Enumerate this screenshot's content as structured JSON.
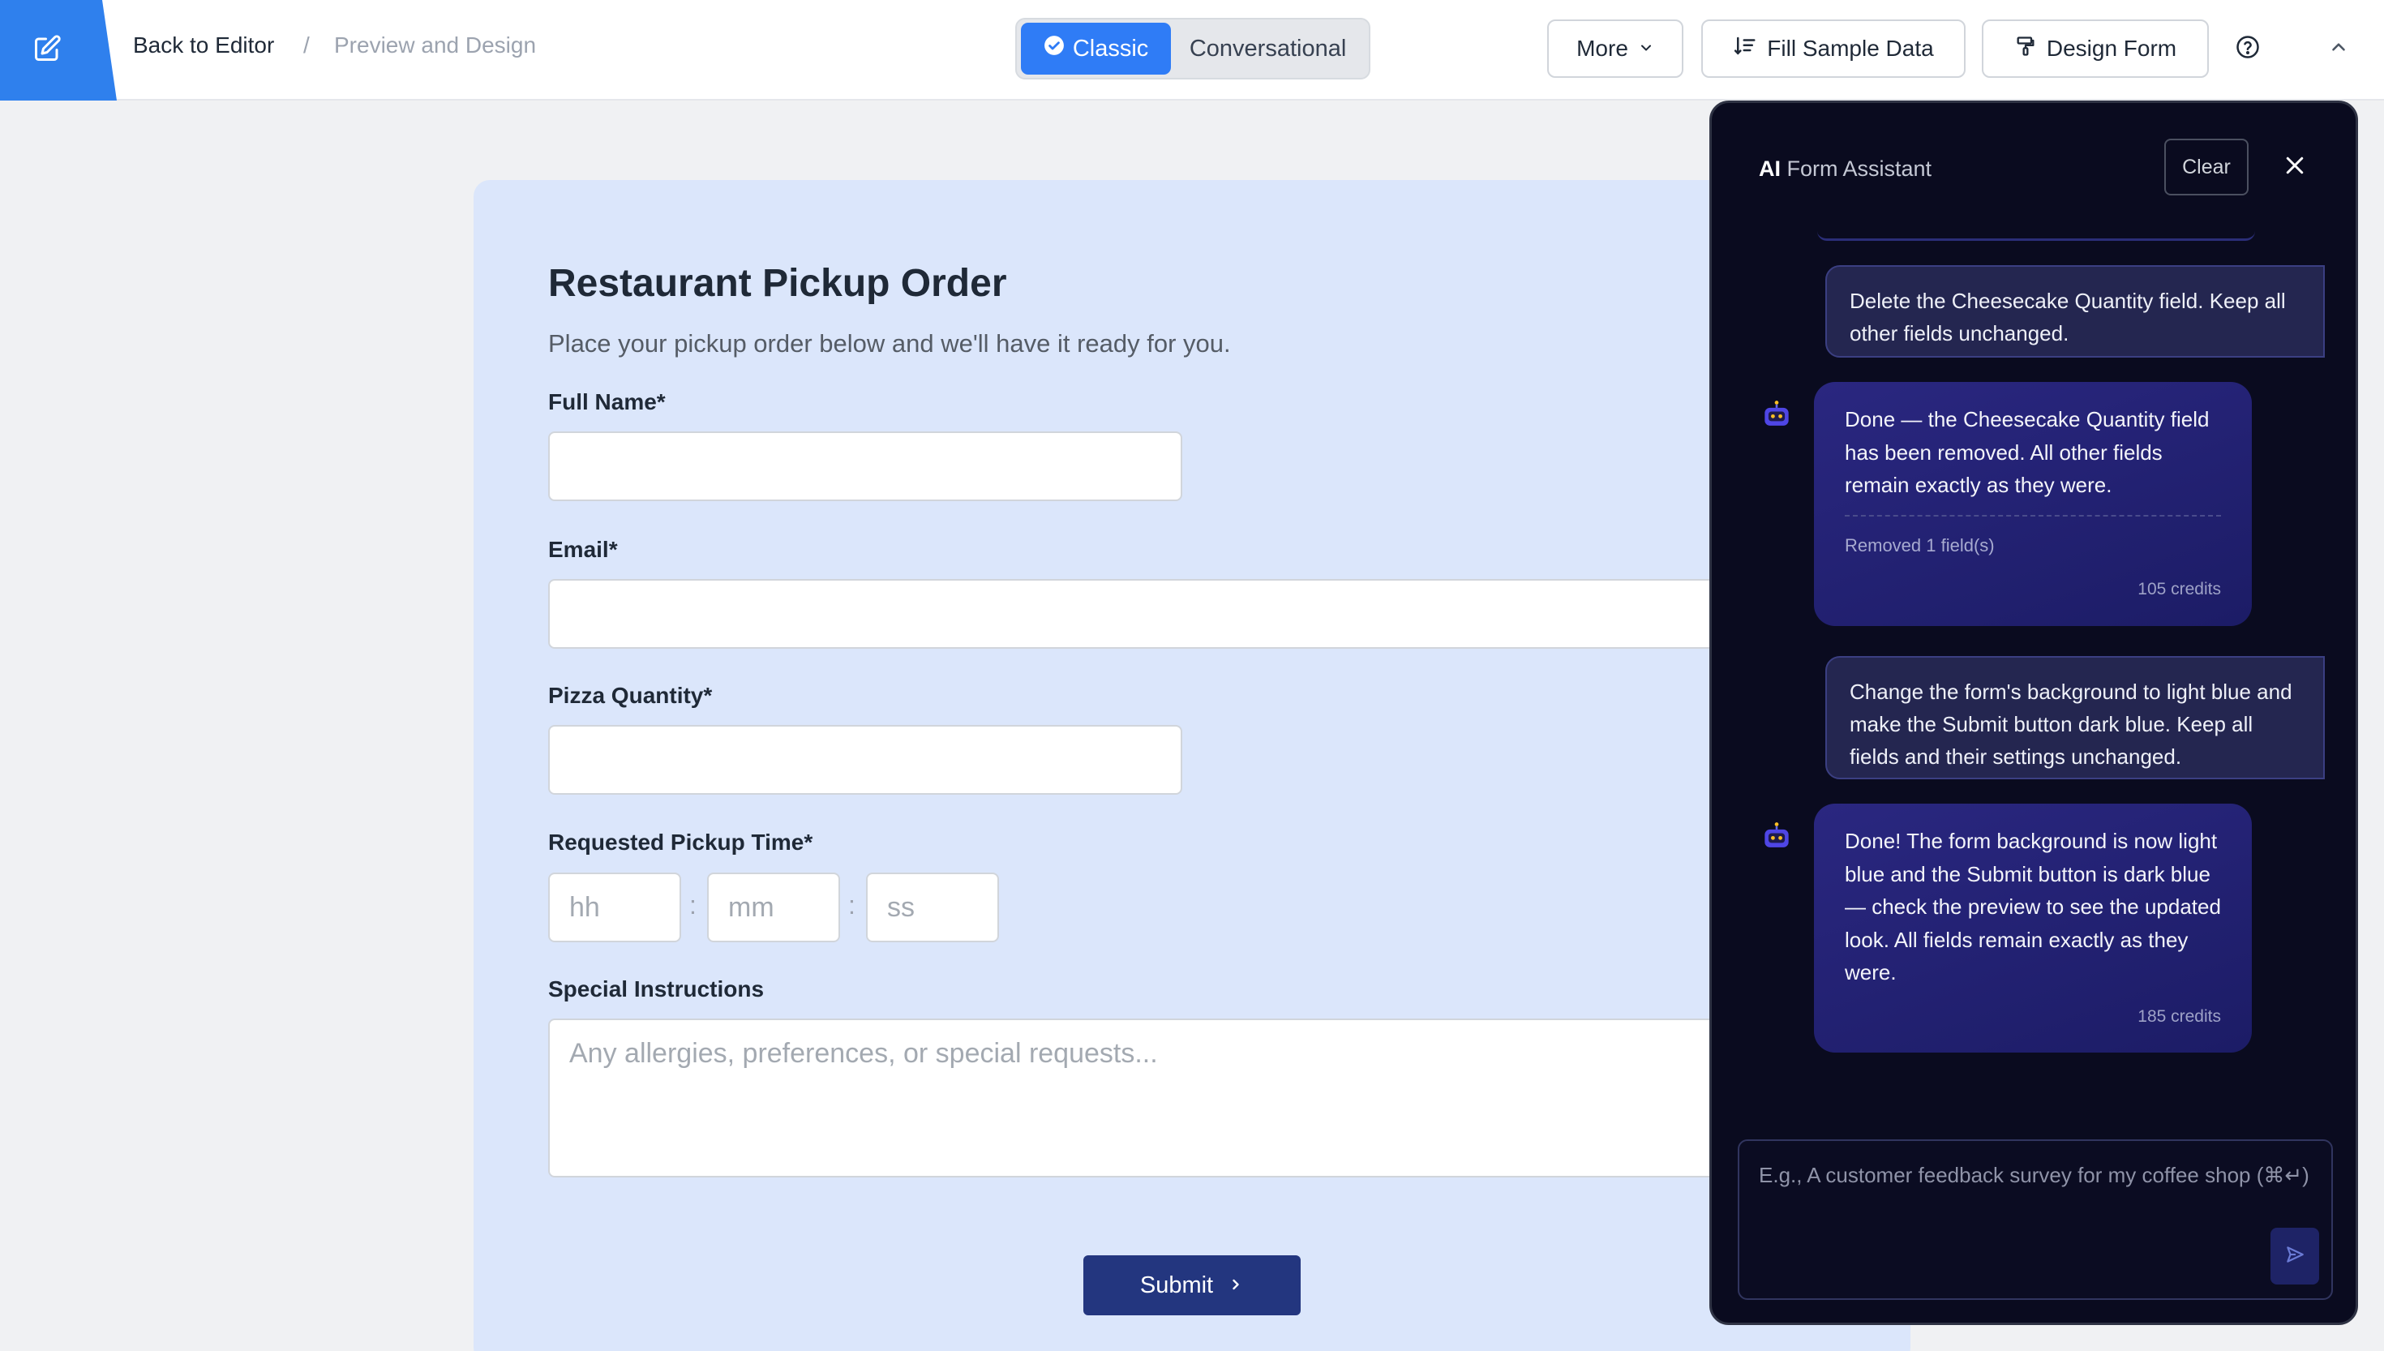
{
  "topbar": {
    "back_label": "Back to Editor",
    "separator": "/",
    "current_label": "Preview and Design",
    "modes": {
      "classic": "Classic",
      "conversational": "Conversational"
    },
    "more_label": "More",
    "fill_sample_label": "Fill Sample Data",
    "design_form_label": "Design Form"
  },
  "form": {
    "title": "Restaurant Pickup Order",
    "subtitle": "Place your pickup order below and we'll have it ready for you.",
    "fields": {
      "full_name": "Full Name*",
      "email": "Email*",
      "pizza_quantity": "Pizza Quantity*",
      "pickup_time": "Requested Pickup Time*",
      "special_instructions": "Special Instructions"
    },
    "time_placeholders": {
      "hh": "hh",
      "mm": "mm",
      "ss": "ss",
      "colon": ":"
    },
    "instructions_placeholder": "Any allergies, preferences, or special requests...",
    "submit_label": "Submit",
    "background_color": "#dbe6fb",
    "submit_color": "#23367f"
  },
  "assistant": {
    "title_bold": "AI",
    "title_rest": " Form Assistant",
    "clear_label": "Clear",
    "messages": [
      {
        "role": "user",
        "text": "Delete the Cheesecake Quantity field. Keep all other fields unchanged."
      },
      {
        "role": "bot",
        "text": "Done — the Cheesecake Quantity field has been removed. All other fields remain exactly as they were.",
        "meta": "Removed 1 field(s)",
        "credits": "105 credits"
      },
      {
        "role": "user",
        "text": "Change the form's background to light blue and make the Submit button dark blue. Keep all fields and their settings unchanged."
      },
      {
        "role": "bot",
        "text": "Done! The form background is now light blue and the Submit button is dark blue — check the preview to see the updated look. All fields remain exactly as they were.",
        "credits": "185 credits"
      }
    ],
    "input_placeholder": "E.g., A customer feedback survey for my coffee shop (⌘↵)"
  },
  "colors": {
    "accent": "#2f7cf6",
    "panel_bg": "#0a0b1f",
    "bot_bubble": "#2a2780"
  }
}
